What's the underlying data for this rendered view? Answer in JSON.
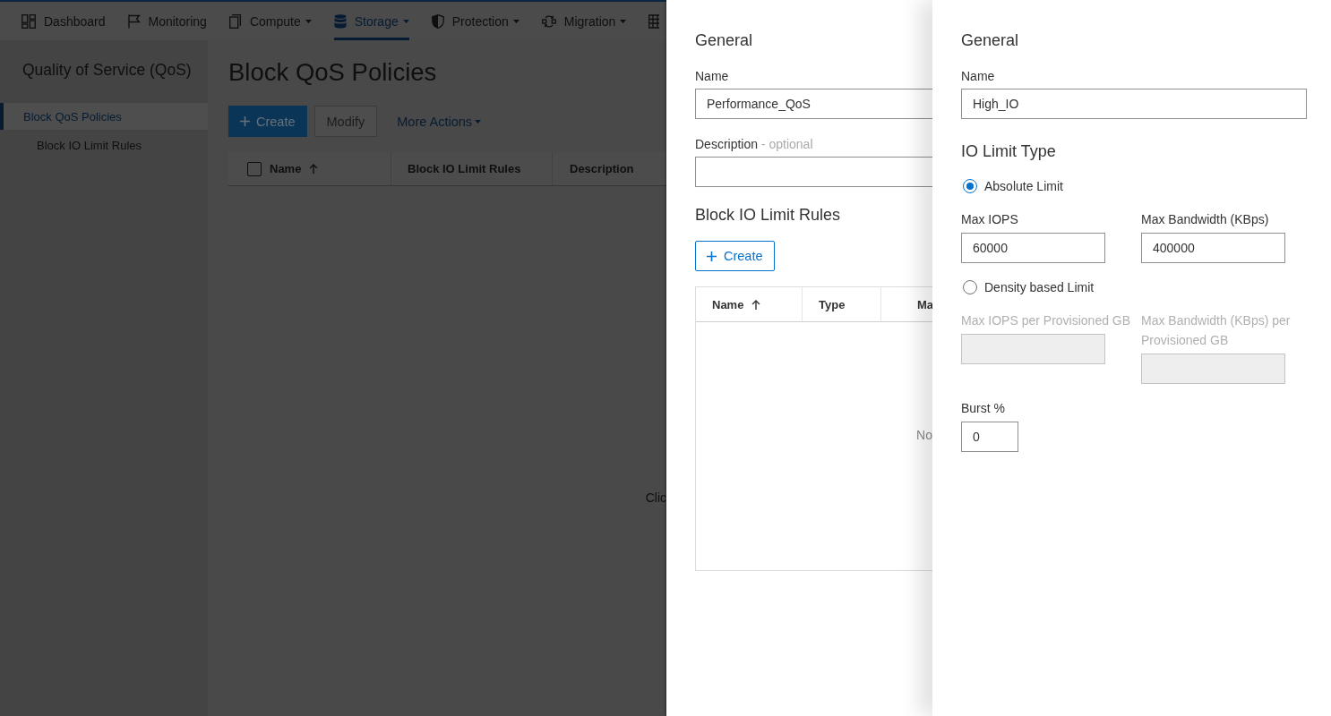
{
  "nav": {
    "items": [
      {
        "label": "Dashboard",
        "has_menu": false,
        "selected": false
      },
      {
        "label": "Monitoring",
        "has_menu": false,
        "selected": false
      },
      {
        "label": "Compute",
        "has_menu": true,
        "selected": false
      },
      {
        "label": "Storage",
        "has_menu": true,
        "selected": true
      },
      {
        "label": "Protection",
        "has_menu": true,
        "selected": false
      },
      {
        "label": "Migration",
        "has_menu": true,
        "selected": false
      }
    ]
  },
  "sidebar": {
    "title": "Quality of Service (QoS)",
    "items": [
      {
        "label": "Block QoS Policies",
        "selected": true,
        "children": [
          {
            "label": "Block IO Limit Rules",
            "selected": false
          }
        ]
      }
    ]
  },
  "main": {
    "title": "Block QoS Policies",
    "toolbar": [
      {
        "kind": "primary",
        "label": "Create",
        "disabled": false
      },
      {
        "kind": "secondary",
        "label": "Modify",
        "disabled": true
      },
      {
        "kind": "menu",
        "label": "More Actions",
        "disabled": false
      }
    ],
    "table": {
      "select_all_checked": false,
      "columns": [
        {
          "label": "Name",
          "sorted": true
        },
        {
          "label": "Block IO Limit Rules",
          "sorted": false
        },
        {
          "label": "Description",
          "sorted": false
        }
      ],
      "empty_message": "Clic"
    }
  },
  "policy_panel": {
    "general": {
      "heading": "General",
      "name": {
        "label": "Name",
        "value": "Performance_QoS"
      },
      "description": {
        "label": "Description",
        "note": "- optional"
      }
    },
    "rules": {
      "heading": "Block IO Limit Rules",
      "create_button": "Create",
      "table": {
        "columns": [
          {
            "label": "Name",
            "sorted": true
          },
          {
            "label": "Type",
            "sorted": false
          },
          {
            "label": "Ma",
            "sorted": false
          }
        ],
        "empty_message": "No"
      }
    }
  },
  "rule_panel": {
    "general": {
      "heading": "General",
      "name": {
        "label": "Name",
        "value": "High_IO"
      }
    },
    "limit_type": {
      "heading": "IO Limit Type",
      "options": [
        {
          "label": "Absolute Limit",
          "selected": true,
          "fields": [
            {
              "label": "Max IOPS",
              "value": "60000",
              "disabled": false
            },
            {
              "label": "Max Bandwidth (KBps)",
              "value": "400000",
              "disabled": false
            }
          ]
        },
        {
          "label": "Density based Limit",
          "selected": false,
          "fields": [
            {
              "label": "Max IOPS per Provisioned GB",
              "disabled": true
            },
            {
              "label": "Max Bandwidth (KBps) per Provisioned GB",
              "disabled": true
            }
          ]
        }
      ]
    },
    "burst": {
      "label": "Burst %",
      "value": "0"
    }
  }
}
